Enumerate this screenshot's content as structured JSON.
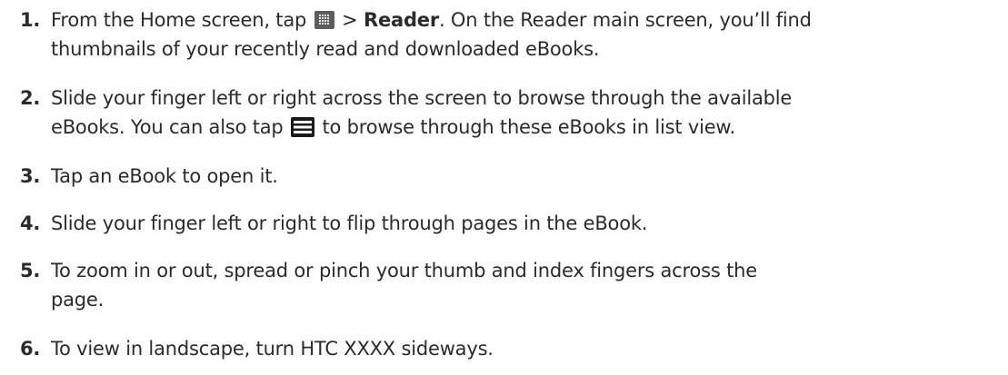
{
  "steps": [
    {
      "number": "1.",
      "line1_a": "From the Home screen, tap ",
      "line1_b": " > ",
      "line1_bold": "Reader",
      "line1_c": ". On the Reader main screen, you’ll find",
      "line2": "thumbnails of your recently read and downloaded eBooks."
    },
    {
      "number": "2.",
      "line1": "Slide your finger left or right across the screen to browse through the available",
      "line2_a": "eBooks. You can also tap ",
      "line2_b": " to browse through these eBooks in list view."
    },
    {
      "number": "3.",
      "line1": "Tap an eBook to open it."
    },
    {
      "number": "4.",
      "line1": "Slide your finger left or right to flip through pages in the eBook."
    },
    {
      "number": "5.",
      "line1": "To zoom in or out, spread or pinch your thumb and index fingers across the",
      "line2": "page."
    },
    {
      "number": "6.",
      "line1": "To view in landscape, turn HTC XXXX sideways."
    }
  ],
  "icons": {
    "all_apps": "all-apps-grid-icon",
    "list_view": "list-view-icon"
  },
  "colors": {
    "text": "#2b2b2b",
    "all_apps_icon_bg": "#5d5d5d",
    "list_icon_bg": "#1a1a1a"
  }
}
